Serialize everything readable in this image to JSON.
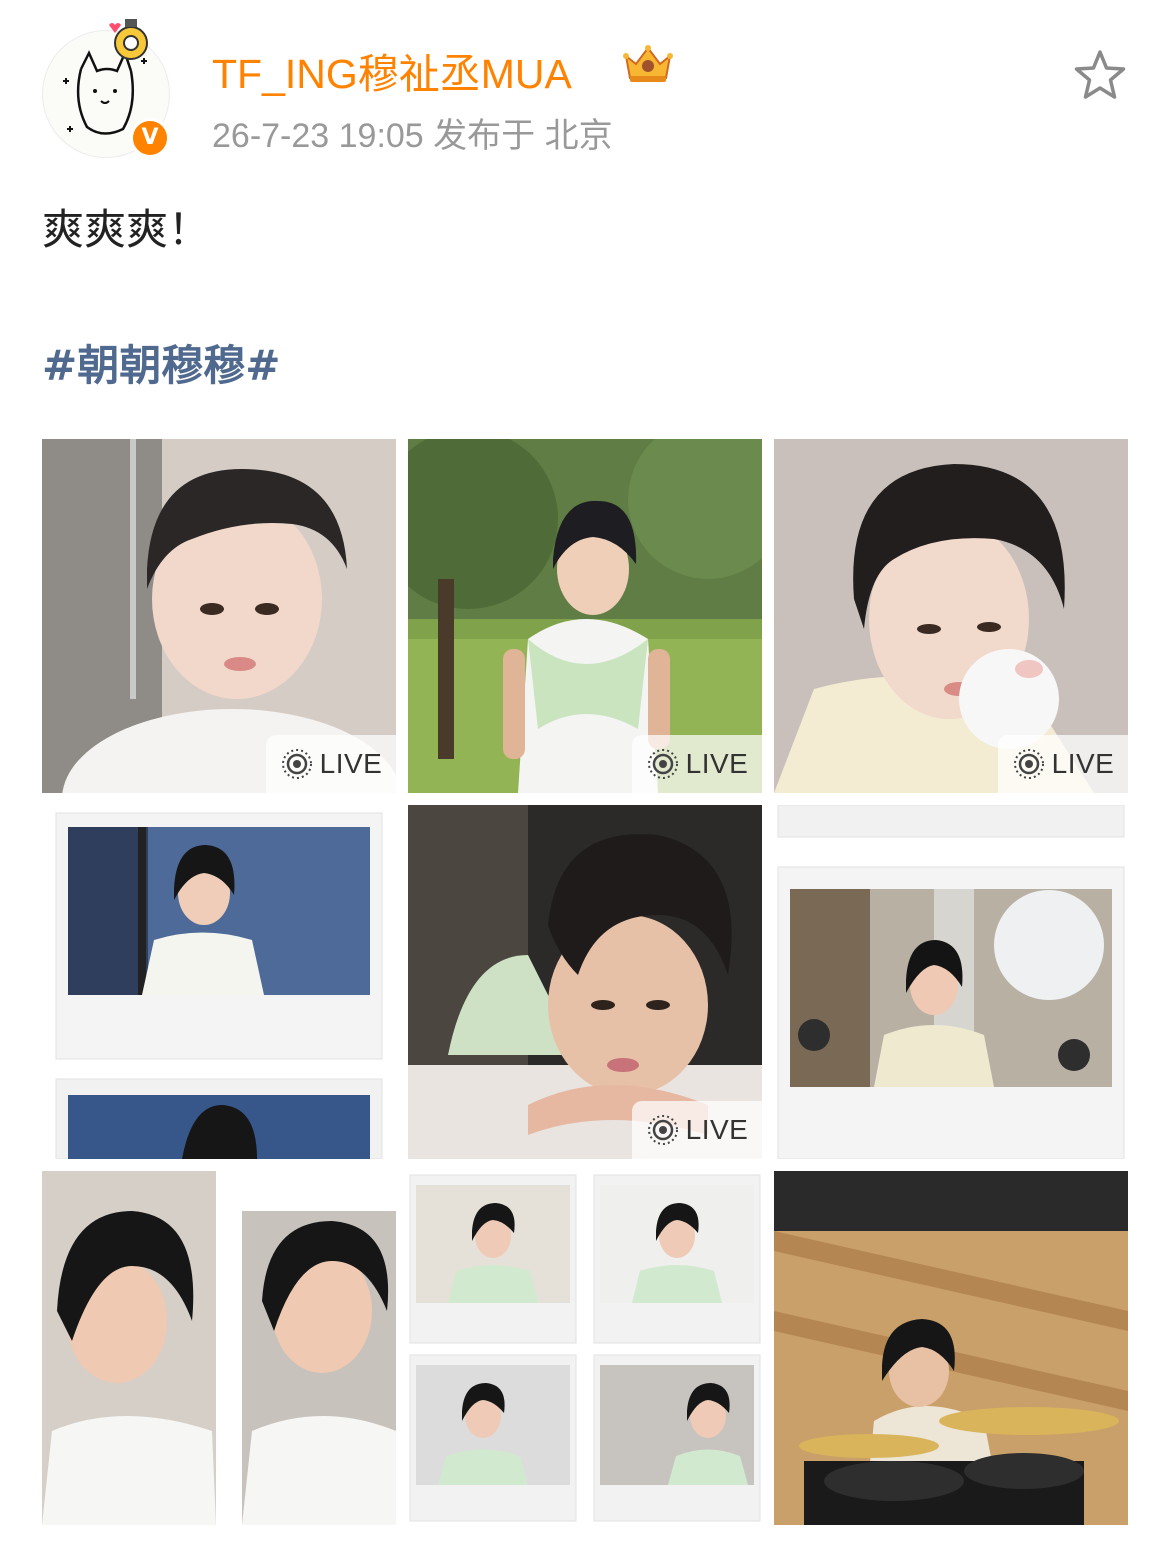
{
  "post": {
    "username": "TF_ING穆祉丞MUA",
    "meta": "26-7-23 19:05  发布于 北京",
    "text": "爽爽爽！",
    "topic": "#朝朝穆穆#",
    "verified_badge": "V",
    "colors": {
      "username": "#ff8200",
      "topic": "#50698f",
      "meta": "#999999",
      "text": "#222222"
    }
  },
  "photos": [
    {
      "name": "photo-1",
      "live": true,
      "live_label": "LIVE"
    },
    {
      "name": "photo-2",
      "live": true,
      "live_label": "LIVE"
    },
    {
      "name": "photo-3",
      "live": true,
      "live_label": "LIVE"
    },
    {
      "name": "photo-4",
      "live": false
    },
    {
      "name": "photo-5",
      "live": true,
      "live_label": "LIVE"
    },
    {
      "name": "photo-6",
      "live": false
    },
    {
      "name": "photo-7",
      "live": false
    },
    {
      "name": "photo-8",
      "live": false
    },
    {
      "name": "photo-9",
      "live": false
    }
  ],
  "icons": {
    "favorite": "star-icon",
    "live": "live-photo-icon",
    "crown": "crown-badge-icon"
  }
}
